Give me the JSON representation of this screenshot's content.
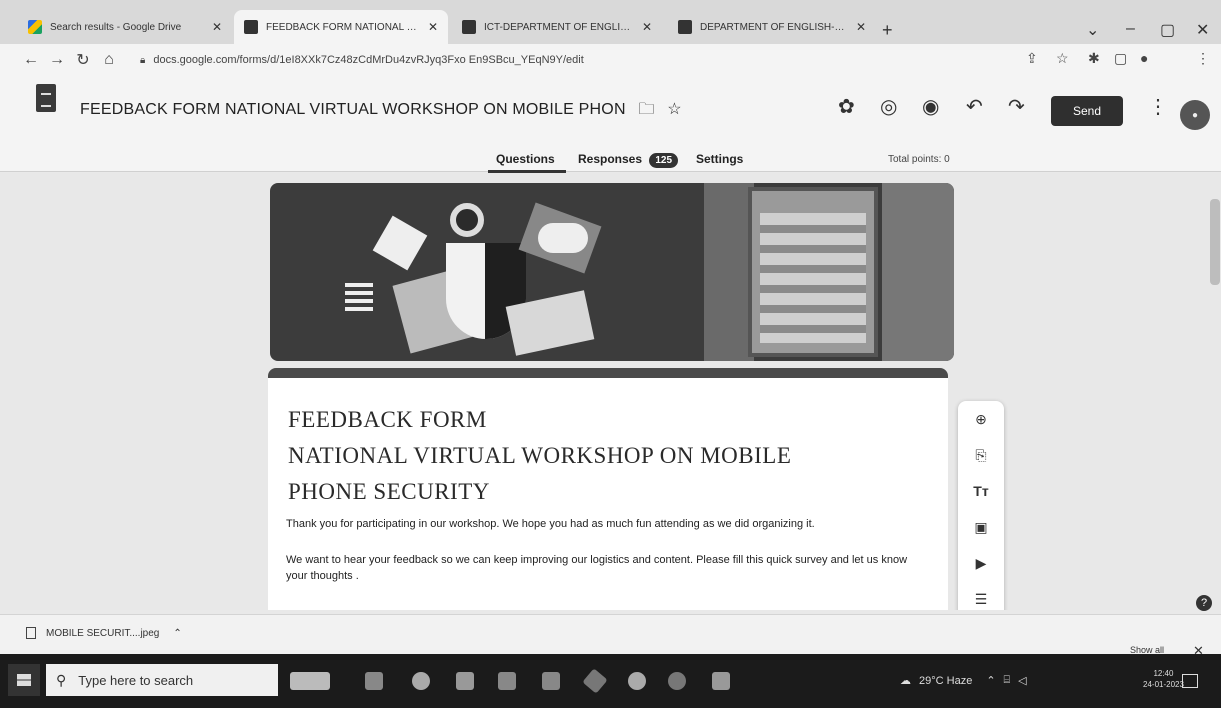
{
  "browser": {
    "tabs": [
      {
        "title": "Search results - Google Drive",
        "active": false
      },
      {
        "title": "FEEDBACK FORM NATIONAL VIR",
        "active": true
      },
      {
        "title": "ICT-DEPARTMENT OF ENGLISH -",
        "active": false
      },
      {
        "title": "DEPARTMENT OF ENGLISH-EVE",
        "active": false
      }
    ],
    "new_tab": "+",
    "url": "docs.google.com/forms/d/1eI8XXk7Cz48zCdMrDu4zvRJyq3Fxo En9SBcu_YEqN9Y/edit"
  },
  "forms": {
    "title": "FEEDBACK FORM  NATIONAL VIRTUAL WORKSHOP ON MOBILE PHON",
    "send_label": "Send",
    "tabs": {
      "questions": "Questions",
      "responses": "Responses",
      "responses_count": "125",
      "settings": "Settings"
    },
    "total_points": "Total points: 0"
  },
  "form_card": {
    "title": "FEEDBACK FORM\n NATIONAL VIRTUAL WORKSHOP ON MOBILE\nPHONE SECURITY",
    "description_1": "Thank you for participating in our workshop. We hope you had as much fun attending as we did organizing it.",
    "description_2": "We want to hear your feedback so we can keep improving our logistics and content. Please fill this quick survey and let us know your thoughts ."
  },
  "downloads": {
    "file": "MOBILE SECURIT....jpeg",
    "show_all": "Show all"
  },
  "taskbar": {
    "search_placeholder": "Type here to search",
    "weather": "29°C  Haze",
    "time": "12:40",
    "date": "24-01-2023"
  },
  "colors": {
    "send_button": "#2f2f2f",
    "taskbar": "#1b1b1b",
    "banner": "#3c3c3c"
  }
}
